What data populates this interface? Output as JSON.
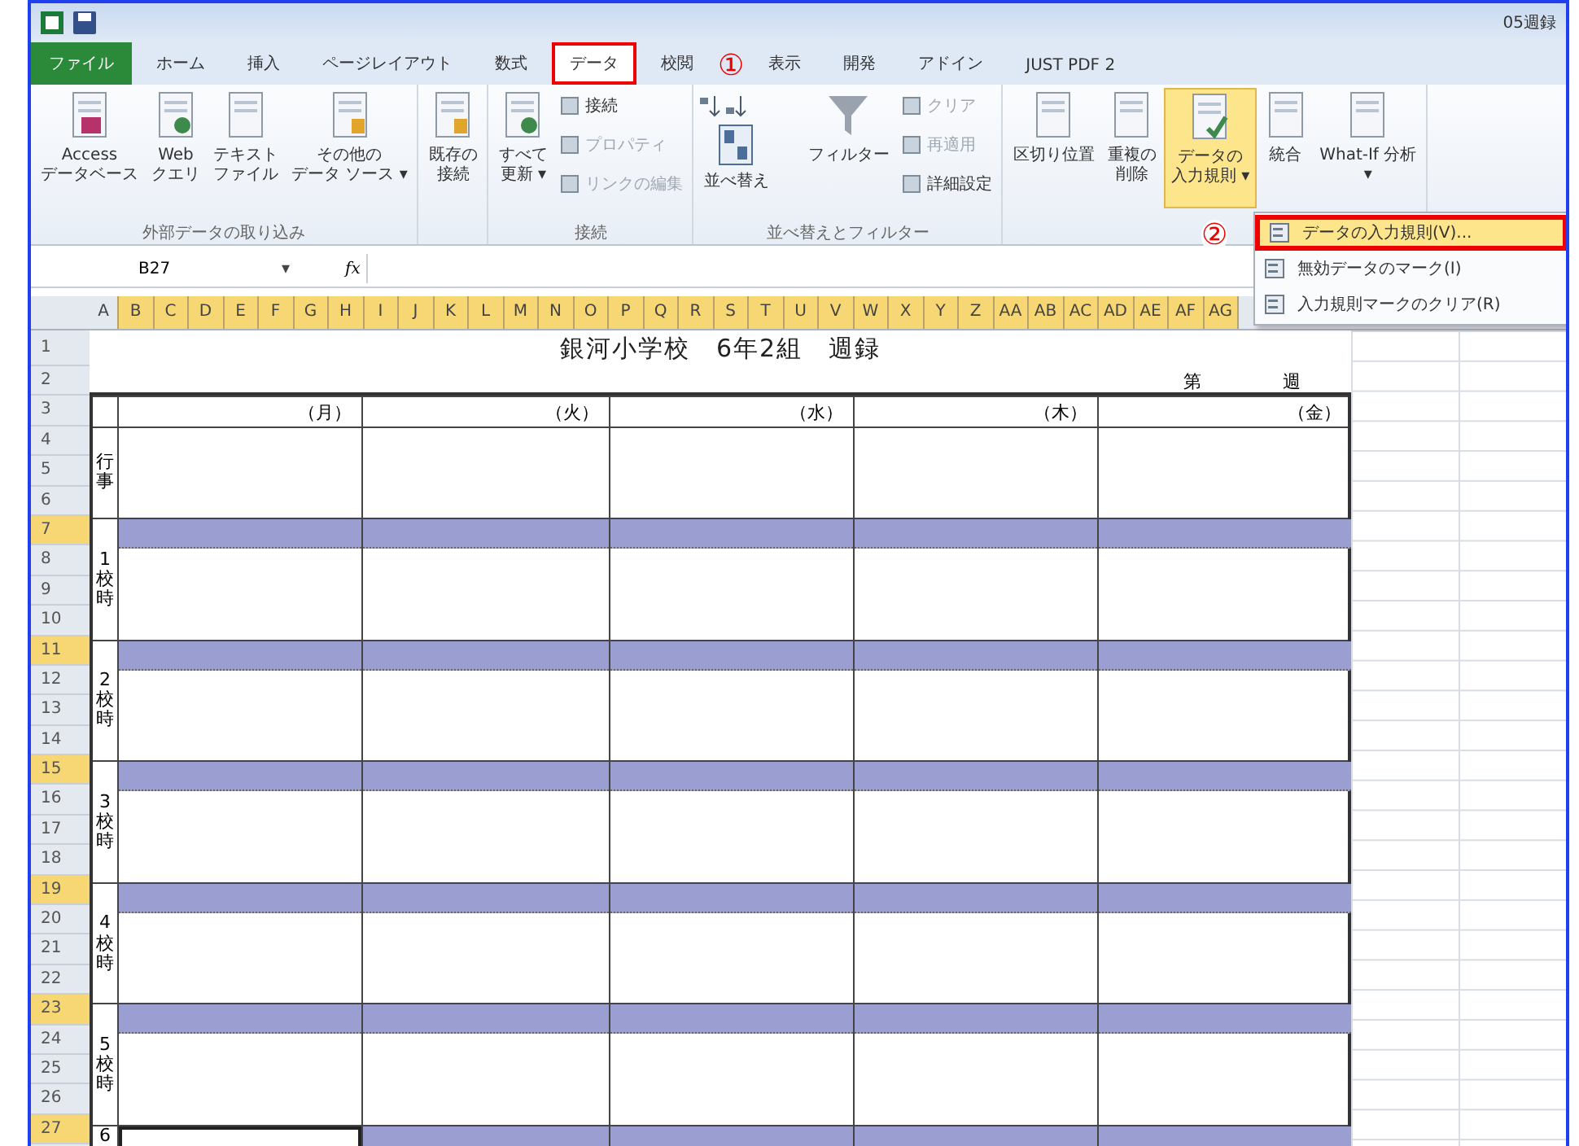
{
  "title_bar": {
    "title": "05週録"
  },
  "tabs": [
    {
      "label": "ファイル",
      "selected": false,
      "kind": "file"
    },
    {
      "label": "ホーム",
      "selected": false,
      "kind": "tab"
    },
    {
      "label": "挿入",
      "selected": false,
      "kind": "tab"
    },
    {
      "label": "ページレイアウト",
      "selected": false,
      "kind": "tab"
    },
    {
      "label": "数式",
      "selected": false,
      "kind": "tab"
    },
    {
      "label": "データ",
      "selected": true,
      "kind": "tab"
    },
    {
      "label": "校閲",
      "selected": false,
      "kind": "tab"
    },
    {
      "label": "表示",
      "selected": false,
      "kind": "tab"
    },
    {
      "label": "開発",
      "selected": false,
      "kind": "tab"
    },
    {
      "label": "アドイン",
      "selected": false,
      "kind": "tab"
    },
    {
      "label": "JUST PDF 2",
      "selected": false,
      "kind": "tab"
    }
  ],
  "ribbon_groups": [
    {
      "label": "外部データの取り込み",
      "buttons": [
        {
          "kind": "large",
          "lines": [
            "Access",
            "データベース"
          ],
          "selected": false
        },
        {
          "kind": "large",
          "lines": [
            "Web",
            "クエリ"
          ],
          "selected": false
        },
        {
          "kind": "large",
          "lines": [
            "テキスト",
            "ファイル"
          ],
          "selected": false
        },
        {
          "kind": "large",
          "lines": [
            "その他の",
            "データ ソース ▾"
          ],
          "selected": false
        }
      ]
    },
    {
      "buttons": [
        {
          "kind": "large",
          "lines": [
            "既存の",
            "接続"
          ],
          "selected": false
        }
      ]
    },
    {
      "label": "接続",
      "buttons": [
        {
          "kind": "large",
          "lines": [
            "すべて",
            "更新 ▾"
          ],
          "selected": false
        },
        {
          "kind": "small",
          "lines": [
            "接続"
          ],
          "disabled": false
        },
        {
          "kind": "small",
          "lines": [
            "プロパティ"
          ],
          "disabled": true
        },
        {
          "kind": "small",
          "lines": [
            "リンクの編集"
          ],
          "disabled": true
        }
      ]
    },
    {
      "label": "並べ替えとフィルター",
      "buttons": [
        {
          "kind": "sort",
          "lines": [
            "並べ替え"
          ],
          "selected": false
        },
        {
          "kind": "filter",
          "lines": [
            "フィルター"
          ],
          "selected": false
        },
        {
          "kind": "small",
          "lines": [
            "クリア"
          ],
          "disabled": true
        },
        {
          "kind": "small",
          "lines": [
            "再適用"
          ],
          "disabled": true
        },
        {
          "kind": "small",
          "lines": [
            "詳細設定"
          ],
          "disabled": false
        }
      ]
    },
    {
      "buttons": [
        {
          "kind": "large",
          "lines": [
            "区切り位置"
          ],
          "selected": false
        },
        {
          "kind": "large",
          "lines": [
            "重複の",
            "削除"
          ],
          "selected": false
        },
        {
          "kind": "large",
          "lines": [
            "データの",
            "入力規則 ▾"
          ],
          "selected": true
        },
        {
          "kind": "large",
          "lines": [
            "統合"
          ],
          "selected": false
        },
        {
          "kind": "large",
          "lines": [
            "What-If 分析",
            "▾"
          ],
          "selected": false
        }
      ]
    }
  ],
  "formula_bar": {
    "name_box": "B27",
    "dropdown": "▾",
    "fx": "fx"
  },
  "column_headers": [
    {
      "label": "A",
      "selected": false
    },
    {
      "label": "B",
      "selected": true
    },
    {
      "label": "C",
      "selected": true
    },
    {
      "label": "D",
      "selected": true
    },
    {
      "label": "E",
      "selected": true
    },
    {
      "label": "F",
      "selected": true
    },
    {
      "label": "G",
      "selected": true
    },
    {
      "label": "H",
      "selected": true
    },
    {
      "label": "I",
      "selected": true
    },
    {
      "label": "J",
      "selected": true
    },
    {
      "label": "K",
      "selected": true
    },
    {
      "label": "L",
      "selected": true
    },
    {
      "label": "M",
      "selected": true
    },
    {
      "label": "N",
      "selected": true
    },
    {
      "label": "O",
      "selected": true
    },
    {
      "label": "P",
      "selected": true
    },
    {
      "label": "Q",
      "selected": true
    },
    {
      "label": "R",
      "selected": true
    },
    {
      "label": "S",
      "selected": true
    },
    {
      "label": "T",
      "selected": true
    },
    {
      "label": "U",
      "selected": true
    },
    {
      "label": "V",
      "selected": true
    },
    {
      "label": "W",
      "selected": true
    },
    {
      "label": "X",
      "selected": true
    },
    {
      "label": "Y",
      "selected": true
    },
    {
      "label": "Z",
      "selected": true
    },
    {
      "label": "AA",
      "selected": true
    },
    {
      "label": "AB",
      "selected": true
    },
    {
      "label": "AC",
      "selected": true
    },
    {
      "label": "AD",
      "selected": true
    },
    {
      "label": "AE",
      "selected": true
    },
    {
      "label": "AF",
      "selected": true
    },
    {
      "label": "AG",
      "selected": true
    }
  ],
  "row_headers": [
    {
      "label": "1",
      "selected": false
    },
    {
      "label": "2",
      "selected": false
    },
    {
      "label": "3",
      "selected": false
    },
    {
      "label": "4",
      "selected": false
    },
    {
      "label": "5",
      "selected": false
    },
    {
      "label": "6",
      "selected": false
    },
    {
      "label": "7",
      "selected": true
    },
    {
      "label": "8",
      "selected": false
    },
    {
      "label": "9",
      "selected": false
    },
    {
      "label": "10",
      "selected": false
    },
    {
      "label": "11",
      "selected": true
    },
    {
      "label": "12",
      "selected": false
    },
    {
      "label": "13",
      "selected": false
    },
    {
      "label": "14",
      "selected": false
    },
    {
      "label": "15",
      "selected": true
    },
    {
      "label": "16",
      "selected": false
    },
    {
      "label": "17",
      "selected": false
    },
    {
      "label": "18",
      "selected": false
    },
    {
      "label": "19",
      "selected": true
    },
    {
      "label": "20",
      "selected": false
    },
    {
      "label": "21",
      "selected": false
    },
    {
      "label": "22",
      "selected": false
    },
    {
      "label": "23",
      "selected": true
    },
    {
      "label": "24",
      "selected": false
    },
    {
      "label": "25",
      "selected": false
    },
    {
      "label": "26",
      "selected": false
    },
    {
      "label": "27",
      "selected": true
    }
  ],
  "sheet": {
    "title": "銀河小学校　6年2組　週録",
    "week_prefix": "第",
    "week_suffix": "週",
    "days": [
      "（月）",
      "（火）",
      "（水）",
      "（木）",
      "（金）"
    ],
    "event_label": "行事",
    "periods": [
      {
        "label": "1校時",
        "slots": [
          {
            "selected": false
          },
          {
            "selected": false
          },
          {
            "selected": false
          },
          {
            "selected": false
          },
          {
            "selected": false
          }
        ]
      },
      {
        "label": "2校時",
        "slots": [
          {
            "selected": false
          },
          {
            "selected": false
          },
          {
            "selected": false
          },
          {
            "selected": false
          },
          {
            "selected": false
          }
        ]
      },
      {
        "label": "3校時",
        "slots": [
          {
            "selected": false
          },
          {
            "selected": false
          },
          {
            "selected": false
          },
          {
            "selected": false
          },
          {
            "selected": false
          }
        ]
      },
      {
        "label": "4校時",
        "slots": [
          {
            "selected": false
          },
          {
            "selected": false
          },
          {
            "selected": false
          },
          {
            "selected": false
          },
          {
            "selected": false
          }
        ]
      },
      {
        "label": "5校時",
        "slots": [
          {
            "selected": false
          },
          {
            "selected": false
          },
          {
            "selected": false
          },
          {
            "selected": false
          },
          {
            "selected": false
          }
        ]
      },
      {
        "label": "6",
        "slots": [
          {
            "selected": true
          },
          {
            "selected": false
          },
          {
            "selected": false
          },
          {
            "selected": false
          },
          {
            "selected": false
          }
        ]
      }
    ]
  },
  "dropdown_menu": [
    {
      "label": "データの入力規則(V)...",
      "selected": true
    },
    {
      "label": "無効データのマーク(I)",
      "selected": false
    },
    {
      "label": "入力規則マークのクリア(R)",
      "selected": false
    }
  ],
  "annotations": [
    "①",
    "②"
  ]
}
